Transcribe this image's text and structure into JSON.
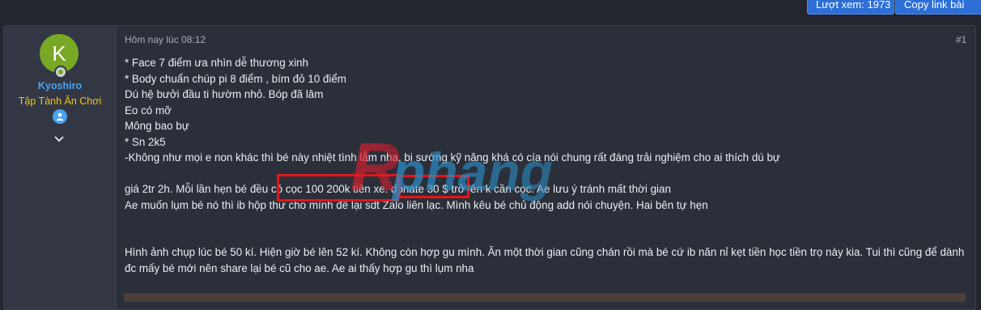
{
  "toolbar": {
    "views_label": "Lượt xem: 1973",
    "copy_link_label": "Copy link bài"
  },
  "user": {
    "avatar_letter": "K",
    "name": "Kyoshiro",
    "title": "Tập Tành Ăn Chơi"
  },
  "post": {
    "date": "Hôm nay lúc 08:12",
    "number": "#1",
    "lines": [
      "* Face 7 điểm ưa nhìn dễ thương xinh",
      "* Body chuẩn chúp pi 8 điểm , bím đỏ 10 điểm",
      "Dú hệ bưởi đầu ti hườm nhỏ. Bóp đã lâm",
      "Eo có mỡ",
      "Mông bao bự",
      "* Sn 2k5",
      "-Không như mọi e non khác thì bé này nhiệt tình lắm nha, bị sướng kỹ năng khá có cía nói chung rất đáng trải nghiệm cho ai thích dú bự",
      "",
      "giá 2tr 2h. Mỗi lần hẹn bé đều có cọc 100 200k tiền xe. donate 30 $ trở lên k cần cọc. Ae lưu ý tránh mất thời gian",
      "Ae muốn lụm bé nó thì ib hộp thư cho mình để lại sdt Zalo liên lạc. Mình kêu bé chủ động add nói chuyện. Hai bên tự hẹn",
      "",
      "",
      "Hình ảnh chụp lúc bé 50 kí. Hiện giờ bé lên 52 kí. Không còn hợp gu mình. Ăn một thời gian cũng chán rồi mà bé cứ ib năn nỉ kẹt tiền học tiền trọ này kia. Tui thì cũng để dành đc mấy bé mới nên share lại bé cũ cho ae. Ae ai thấy hợp gu thì lụm nha"
    ]
  },
  "watermark": {
    "text": "Rphang"
  },
  "colors": {
    "accent": "#2d6fd6",
    "username": "#4aa3f0",
    "user_title": "#f0c419",
    "highlight": "#e3161c",
    "watermark_red": "#d41e2c",
    "watermark_blue": "#2a8fc9"
  },
  "icons": {
    "badge": "user-badge-icon",
    "expand": "chevron-down-icon"
  }
}
